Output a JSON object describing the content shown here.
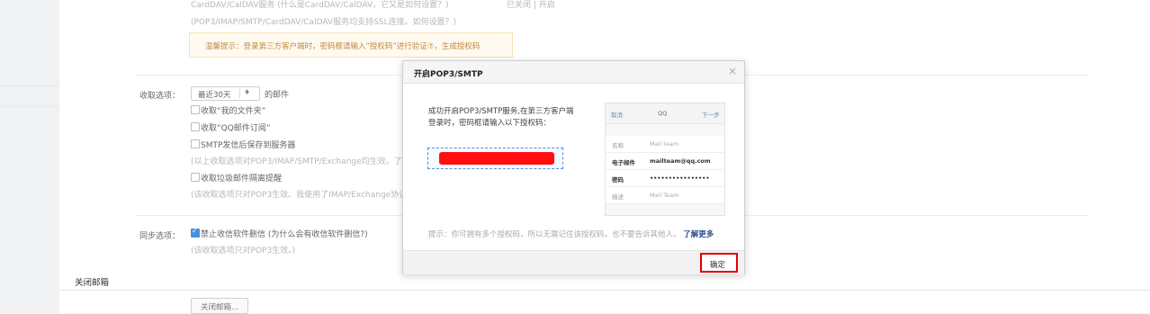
{
  "top": {
    "line1": "CardDAV/CalDAV服务 (什么是CardDAV/CalDAV，它又是如何设置？)",
    "line1_status": "已关闭 | 开启",
    "line2": "(POP3/IMAP/SMTP/CardDAV/CalDAV服务均支持SSL连接。如何设置？)",
    "tip": "温馨提示：登录第三方客户端时，密码框请输入“授权码”进行验证⑦，生成授权码"
  },
  "receive": {
    "label": "收取选项：",
    "select_value": "最近30天",
    "select_arrow": "♦",
    "select_suffix": "的邮件",
    "options": [
      {
        "label": "收取“我的文件夹”",
        "checked": false
      },
      {
        "label": "收取“QQ邮件订阅”",
        "checked": false
      },
      {
        "label": "SMTP发信后保存到服务器",
        "checked": false
      }
    ],
    "note1": "(以上收取选项对POP3/IMAP/SMTP/Exchange均生效。了",
    "junk_option": "收取垃圾邮件隔离提醒",
    "note2": "(该收取选项只对POP3生效。我使用了IMAP/Exchange协议"
  },
  "sync": {
    "label": "同步选项：",
    "option": "禁止收信软件删信  (为什么会有收信软件删信?)",
    "note": "(该收取选项只对POP3生效。)"
  },
  "close_section": {
    "title": "关闭邮箱",
    "button": "关闭邮箱..."
  },
  "dialog": {
    "title": "开启POP3/SMTP",
    "close_icon": "×",
    "text_line1": "成功开启POP3/SMTP服务,在第三方客户端",
    "text_line2": "登录时，密码框请输入以下授权码：",
    "phone": {
      "cancel": "取消",
      "title": "QQ",
      "next": "下一步",
      "rows": [
        {
          "label": "名称",
          "value": "Mail team"
        },
        {
          "label": "电子邮件",
          "value": "mailteam@qq.com"
        },
        {
          "label": "密码",
          "value": "••••••••••••••••"
        },
        {
          "label": "描述",
          "value": "Mail Team"
        }
      ]
    },
    "hint": "提示：你可拥有多个授权码，所以无需记住该授权码，也不要告诉其他人。",
    "hint_link": "了解更多",
    "ok_button": "确定"
  },
  "colors": {
    "accent": "#4a8fe3",
    "highlight": "#e10000",
    "redacted": "#ff0f0f"
  }
}
